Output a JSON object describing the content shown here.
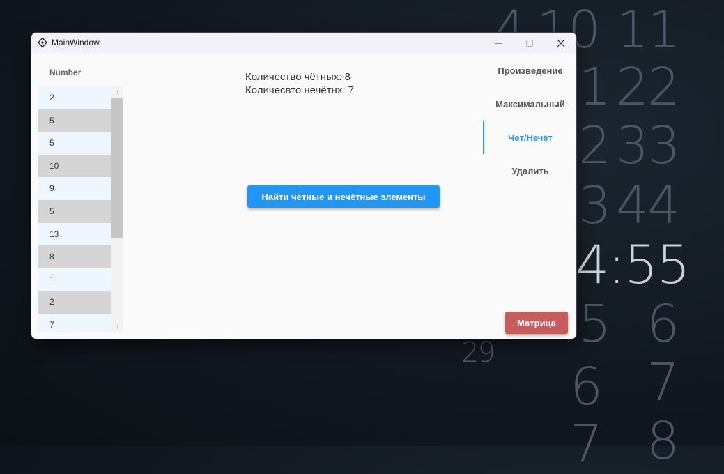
{
  "background_clock": {
    "digits": [
      "4",
      "10",
      "11",
      "1",
      "22",
      "2",
      "33",
      "3",
      "44",
      "4:55",
      "5",
      "6",
      "29",
      "6",
      "7",
      "7",
      "8"
    ]
  },
  "window": {
    "title": "MainWindow",
    "controls": {
      "minimize": "minimize-icon",
      "maximize": "maximize-icon",
      "close": "close-icon"
    }
  },
  "list": {
    "header": "Number",
    "items": [
      "2",
      "5",
      "5",
      "10",
      "9",
      "5",
      "13",
      "8",
      "1",
      "2",
      "7"
    ]
  },
  "stats": {
    "even": "Количество чётных: 8",
    "odd": "Количесвто нечётнх: 7"
  },
  "action_button": "Найти чётные и нечётные элементы",
  "nav": {
    "items": [
      "Произведение",
      "Максимальный",
      "Чёт/Нечёт",
      "Удалить"
    ],
    "active": "Чёт/Нечёт"
  },
  "matrix_button": "Матрица",
  "colors": {
    "accent": "#2196f3",
    "matrix_button": "#c75c5c"
  }
}
